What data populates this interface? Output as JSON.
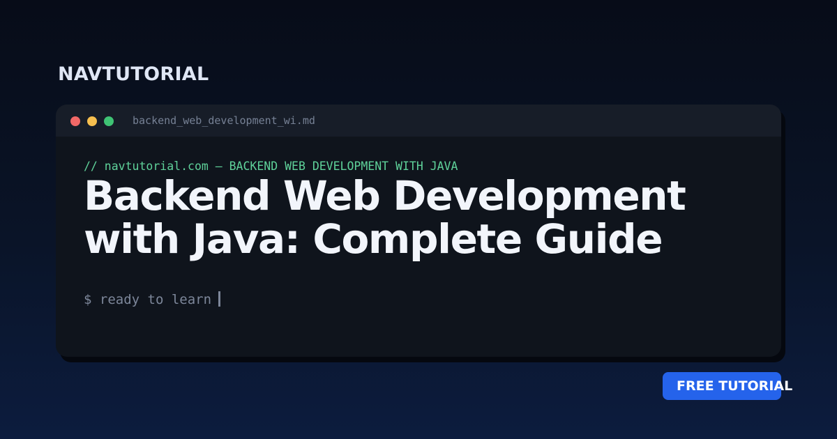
{
  "brand": {
    "name": "NAVTUTORIAL"
  },
  "window": {
    "filename": "backend_web_development_wi.md",
    "traffic_lights": [
      "close-dot",
      "minimize-dot",
      "maximize-dot"
    ],
    "colors": {
      "red": "#f16867",
      "yellow": "#f6bf4f",
      "green": "#3fc374"
    }
  },
  "content": {
    "comment": "// navtutorial.com — BACKEND WEB DEVELOPMENT WITH JAVA",
    "headline_line1": "Backend Web Development",
    "headline_line2": "with Java: Complete Guide",
    "prompt": "$ ready to learn"
  },
  "badge": {
    "label": "FREE TUTORIAL"
  },
  "colors": {
    "accent": "#2563eb",
    "comment": "#5fd29a",
    "background": "#0a1428"
  }
}
